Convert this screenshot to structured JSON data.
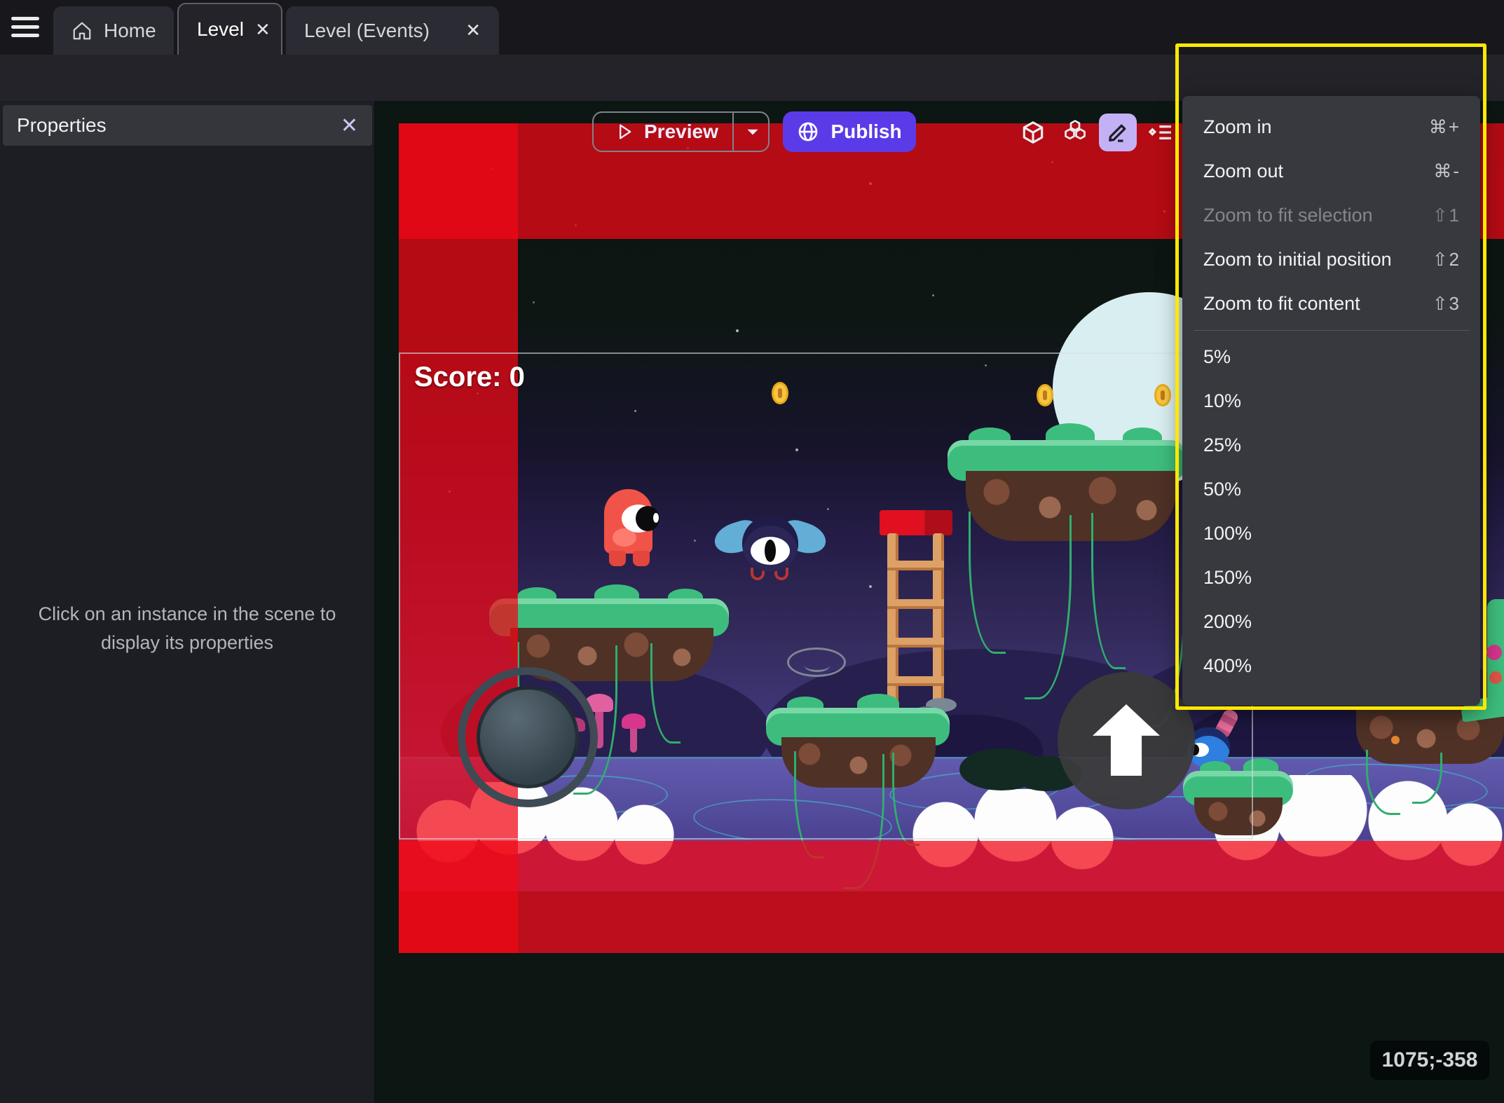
{
  "window": {
    "tabs": {
      "home_label": "Home",
      "level_label": "Level",
      "events_label": "Level (Events)",
      "close_glyph": "✕"
    }
  },
  "toolbar": {
    "preview_label": "Preview",
    "publish_label": "Publish"
  },
  "properties_panel": {
    "title": "Properties",
    "close_glyph": "✕",
    "empty_message_line1": "Click on an instance in the scene to",
    "empty_message_line2": "display its properties"
  },
  "scene": {
    "score_text": "Score: 0",
    "cursor_coordinates": "1075;-358"
  },
  "zoom_menu": {
    "items": [
      {
        "label": "Zoom in",
        "shortcut": "⌘+"
      },
      {
        "label": "Zoom out",
        "shortcut": "⌘-"
      },
      {
        "label": "Zoom to fit selection",
        "shortcut": "⇧1",
        "disabled": true
      },
      {
        "label": "Zoom to initial position",
        "shortcut": "⇧2"
      },
      {
        "label": "Zoom to fit content",
        "shortcut": "⇧3"
      }
    ],
    "percents": [
      "5%",
      "10%",
      "25%",
      "50%",
      "100%",
      "150%",
      "200%",
      "400%"
    ]
  },
  "colors": {
    "publish_purple": "#5b3be8",
    "tool_active_lavender": "#c3b1f6",
    "highlight_yellow": "#fce803",
    "overlay_red": "#e50914",
    "menu_bg": "#37393f"
  }
}
